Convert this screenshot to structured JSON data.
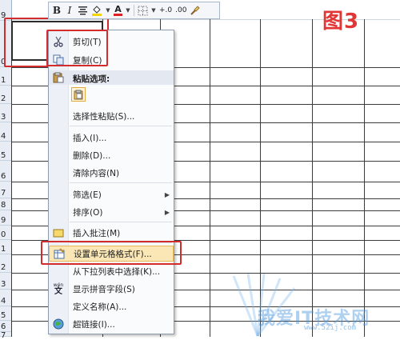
{
  "row_numbers": [
    "9",
    "0",
    "1",
    "2",
    "3",
    "4",
    "5",
    "6",
    "7",
    "8",
    "9",
    "0",
    "1",
    "2",
    "3",
    "4",
    "5",
    "6",
    "7"
  ],
  "mini_toolbar": {
    "bold": "B",
    "italic": "I",
    "font_color_glyph": "A",
    "increase_decimal": "+.0",
    "decrease_decimal": ".00",
    "icons": [
      "align-center-icon",
      "fill-color-icon",
      "font-color-icon",
      "border-icon",
      "increase-decimal-icon",
      "decrease-decimal-icon",
      "format-painter-icon"
    ]
  },
  "figure_label": "图3",
  "context_menu": {
    "cut": "剪切(T)",
    "copy": "复制(C)",
    "paste_options_header": "粘贴选项:",
    "paste_special": "选择性粘贴(S)...",
    "insert": "插入(I)...",
    "delete": "删除(D)...",
    "clear_contents": "清除内容(N)",
    "filter": "筛选(E)",
    "sort": "排序(O)",
    "insert_comment": "插入批注(M)",
    "format_cells": "设置单元格格式(F)...",
    "pick_from_list": "从下拉列表中选择(K)...",
    "show_phonetic": "显示拼音字段(S)",
    "define_name": "定义名称(A)...",
    "hyperlink": "超链接(I)..."
  },
  "colors": {
    "highlight_red": "#d22c2c",
    "figure_label_red": "#e23636",
    "menu_hover": "#fbe7b5"
  },
  "watermark": {
    "text": "我爱IT技术网",
    "url": "www.52ij.com"
  }
}
